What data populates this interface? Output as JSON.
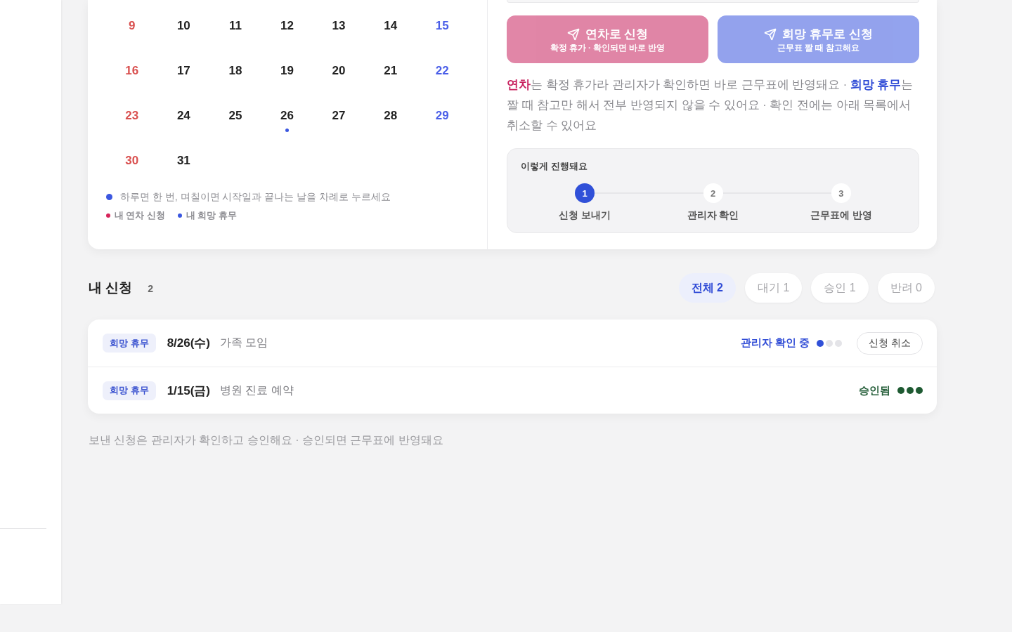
{
  "calendar": {
    "weeks": [
      [
        {
          "label": "9",
          "kind": "sunday"
        },
        {
          "label": "10",
          "kind": "weekday"
        },
        {
          "label": "11",
          "kind": "weekday"
        },
        {
          "label": "12",
          "kind": "weekday"
        },
        {
          "label": "13",
          "kind": "weekday"
        },
        {
          "label": "14",
          "kind": "weekday"
        },
        {
          "label": "15",
          "kind": "saturday"
        }
      ],
      [
        {
          "label": "16",
          "kind": "sunday"
        },
        {
          "label": "17",
          "kind": "weekday"
        },
        {
          "label": "18",
          "kind": "weekday"
        },
        {
          "label": "19",
          "kind": "weekday"
        },
        {
          "label": "20",
          "kind": "weekday"
        },
        {
          "label": "21",
          "kind": "weekday"
        },
        {
          "label": "22",
          "kind": "saturday"
        }
      ],
      [
        {
          "label": "23",
          "kind": "sunday"
        },
        {
          "label": "24",
          "kind": "weekday"
        },
        {
          "label": "25",
          "kind": "weekday"
        },
        {
          "label": "26",
          "kind": "weekday",
          "mark": {
            "color": "#3b57e0"
          }
        },
        {
          "label": "27",
          "kind": "weekday"
        },
        {
          "label": "28",
          "kind": "weekday"
        },
        {
          "label": "29",
          "kind": "saturday"
        }
      ],
      [
        {
          "label": "30",
          "kind": "sunday"
        },
        {
          "label": "31",
          "kind": "weekday"
        }
      ]
    ],
    "hint": {
      "text": "하루면 한 번, 며칠이면 시작일과 끝나는 날을 차례로 누르세요",
      "color": "#3b57e0"
    },
    "legend": [
      {
        "label": "내 연차 신청",
        "color": "#d6245a"
      },
      {
        "label": "내 희망 휴무",
        "color": "#3b57e0"
      }
    ]
  },
  "apply_buttons": [
    {
      "kind": "annual",
      "title": "연차로 신청",
      "subtitle": "확정 휴가 · 확인되면 바로 반영",
      "disabled": true
    },
    {
      "kind": "wish",
      "title": "희망 휴무로 신청",
      "subtitle": "근무표 짤 때 참고해요",
      "disabled": true
    }
  ],
  "explanation": [
    {
      "kind": "annual",
      "text": "연차"
    },
    {
      "kind": "plain",
      "text": "는 확정 휴가라 관리자가 확인하면 바로 근무표에 반영돼요 · "
    },
    {
      "kind": "wish",
      "text": "희망 휴무"
    },
    {
      "kind": "plain",
      "text": "는 짤 때 참고만 해서 전부 반영되지 않을 수 있어요 · 확인 전에는 아래 목록에서 취소할 수 있어요"
    }
  ],
  "process": {
    "title": "이렇게 진행돼요",
    "steps": [
      {
        "number": "1",
        "label": "신청 보내기",
        "active": true
      },
      {
        "number": "2",
        "label": "관리자 확인",
        "active": false
      },
      {
        "number": "3",
        "label": "근무표에 반영",
        "active": false
      }
    ]
  },
  "requests": {
    "title": "내 신청",
    "count": "2",
    "filters": [
      {
        "label": "전체 2",
        "selected": true
      },
      {
        "label": "대기 1",
        "selected": false
      },
      {
        "label": "승인 1",
        "selected": false
      },
      {
        "label": "반려 0",
        "selected": false
      }
    ],
    "items": [
      {
        "kind": "wish",
        "tag": "희망 휴무",
        "date": "8/26(수)",
        "reason": "가족 모임",
        "status": {
          "kind": "pending",
          "label": "관리자 확인 중"
        },
        "progress": [
          {
            "filled": true
          },
          {
            "filled": false
          },
          {
            "filled": false
          }
        ],
        "action": "신청 취소"
      },
      {
        "kind": "wish",
        "tag": "희망 휴무",
        "date": "1/15(금)",
        "reason": "병원 진료 예약",
        "status": {
          "kind": "approved",
          "label": "승인됨"
        },
        "progress": [
          {
            "filled": true
          },
          {
            "filled": true
          },
          {
            "filled": true
          }
        ]
      }
    ]
  },
  "footer_note": "보낸 신청은 관리자가 확인하고 승인해요 · 승인되면 근무표에 반영돼요"
}
